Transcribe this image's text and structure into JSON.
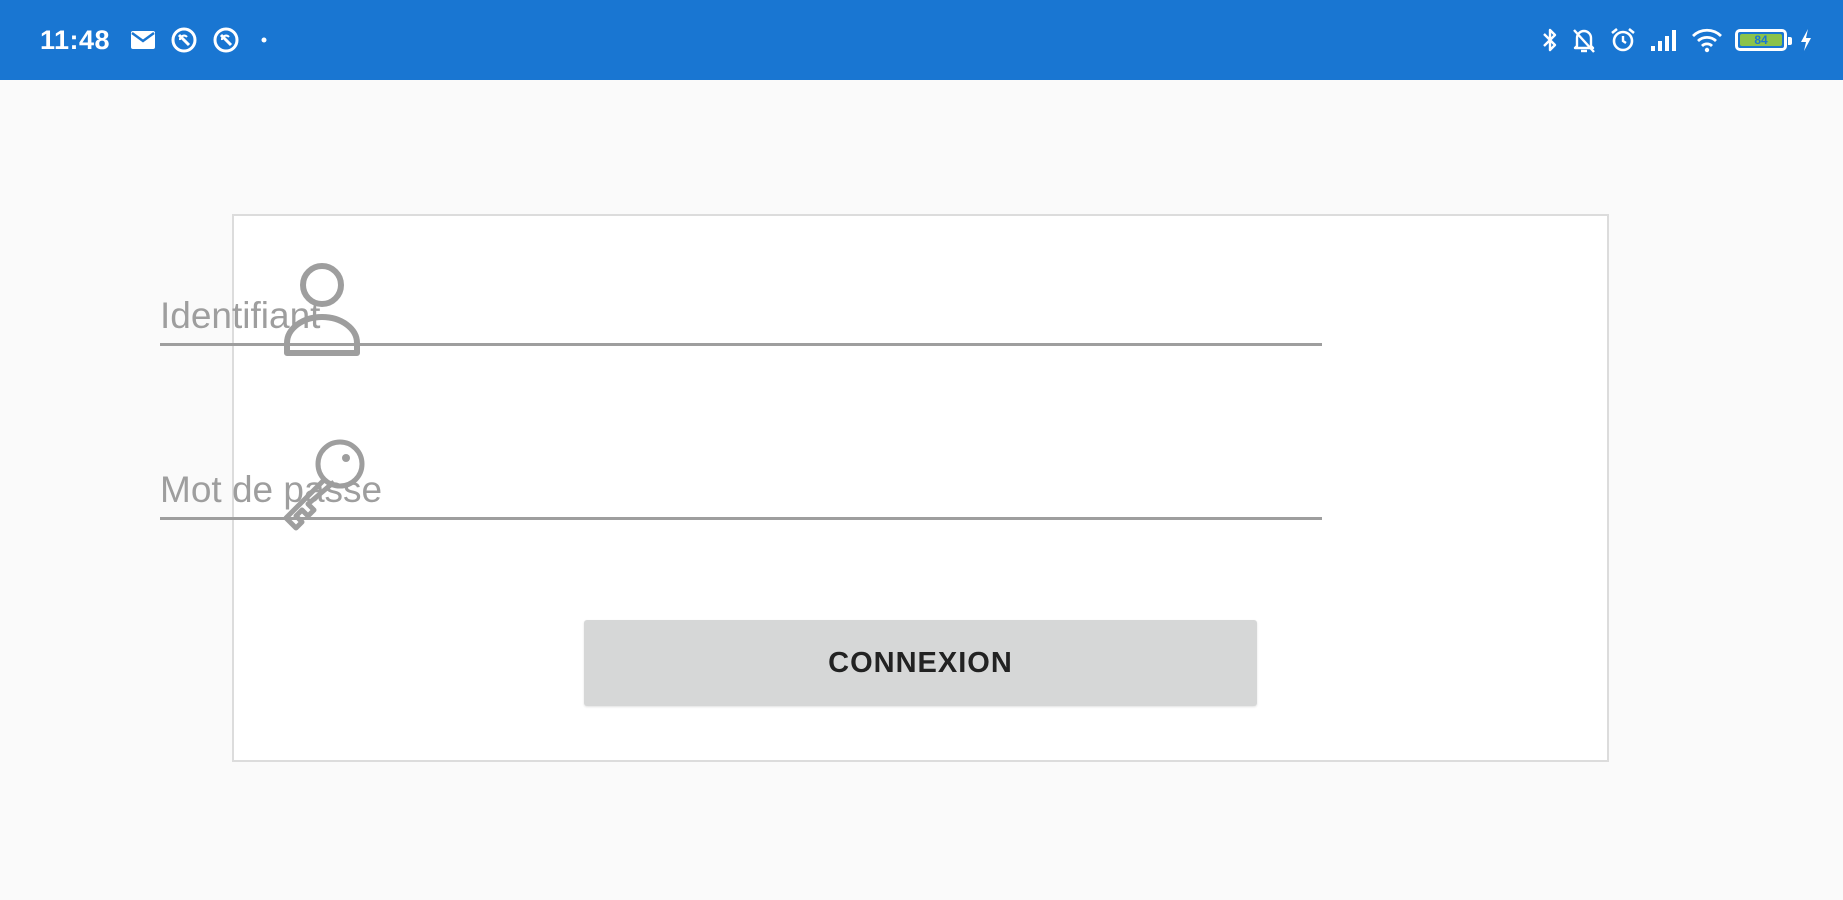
{
  "status_bar": {
    "time": "11:48",
    "left_icons": [
      "mail-icon",
      "sync-disabled-icon",
      "sync-disabled-icon",
      "dot-icon"
    ],
    "right_icons": [
      "bluetooth-icon",
      "bell-off-icon",
      "alarm-icon",
      "signal-icon",
      "wifi-icon",
      "battery-icon",
      "charging-icon"
    ],
    "battery_level": "84",
    "color": "#1976d2"
  },
  "login": {
    "username": {
      "placeholder": "Identifiant",
      "value": ""
    },
    "password": {
      "placeholder": "Mot de passe",
      "value": ""
    },
    "submit_label": "CONNEXION"
  }
}
